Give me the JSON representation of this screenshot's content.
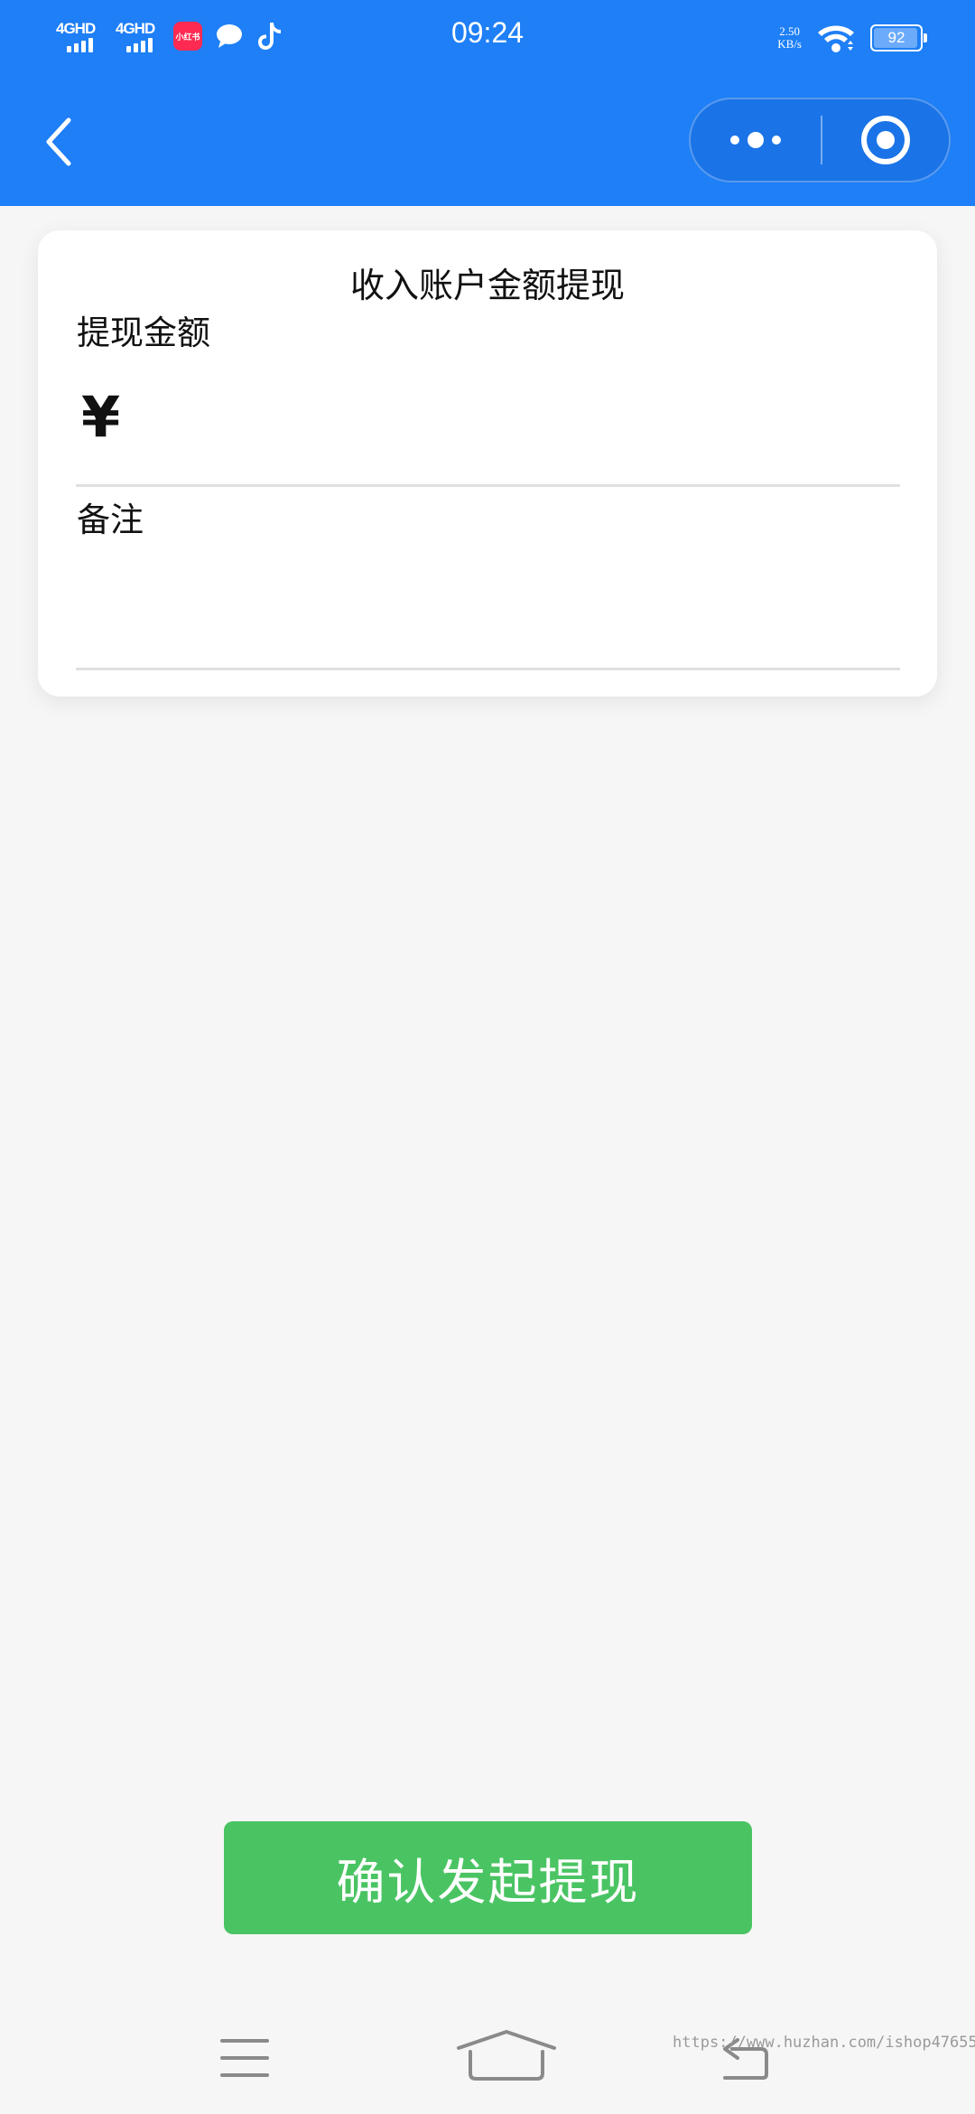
{
  "status_bar": {
    "network_1": "4GHD",
    "network_2": "4GHD",
    "app_badge": "小红书",
    "time": "09:24",
    "speed_value": "2.50",
    "speed_unit": "KB/s",
    "battery": "92"
  },
  "nav_bar": {
    "more_icon": "ellipsis-icon",
    "close_icon": "target-circle-icon",
    "color": "#1e7ff6"
  },
  "card": {
    "title": "收入账户金额提现",
    "amount_label": "提现金额",
    "currency_symbol": "¥",
    "amount_value": "",
    "remark_label": "备注",
    "remark_value": ""
  },
  "confirm_button": {
    "label": "确认发起提现",
    "color": "#4ac463"
  },
  "system_nav": {
    "watermark": "https://www.huzhan.com/ishop47655"
  }
}
